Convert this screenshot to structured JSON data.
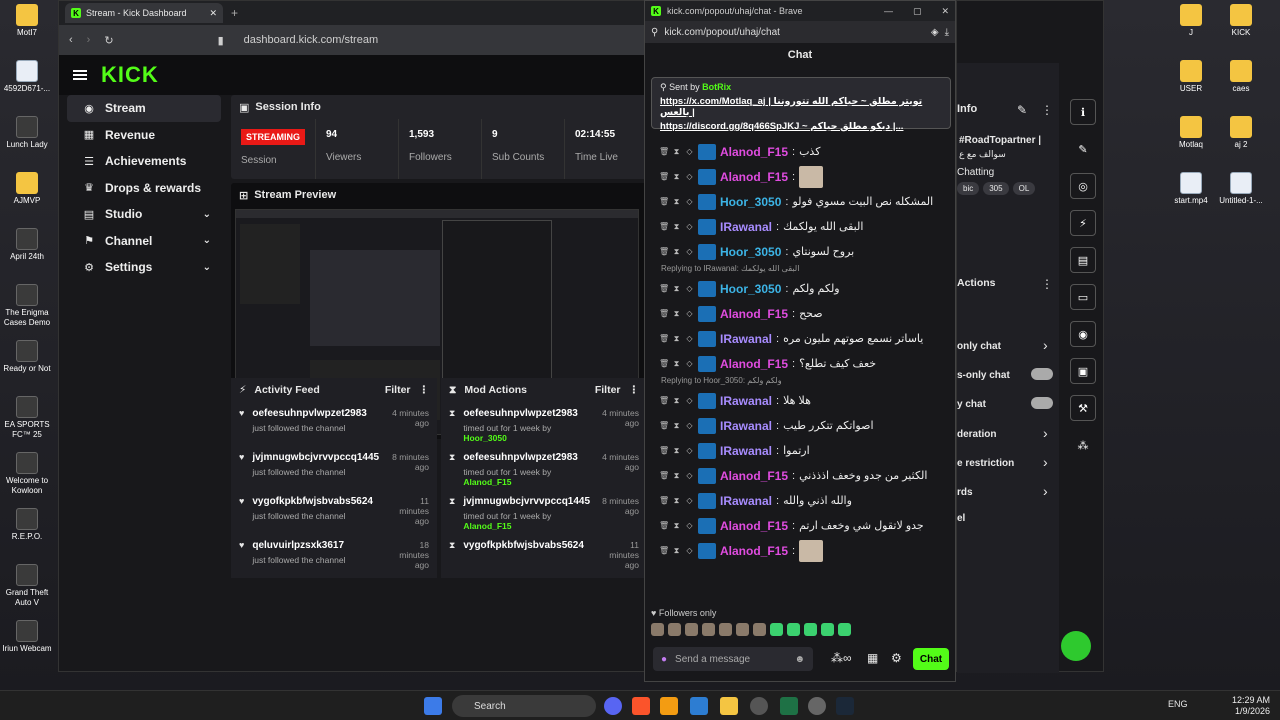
{
  "desktop_left": [
    {
      "label": "MotI7",
      "type": "folder"
    },
    {
      "label": "4592D671-...",
      "type": "file"
    },
    {
      "label": "Lunch Lady",
      "type": "app"
    },
    {
      "label": "AJMVP",
      "type": "folder"
    },
    {
      "label": "April 24th",
      "type": "app"
    },
    {
      "label": "The Enigma Cases Demo",
      "type": "app"
    },
    {
      "label": "Ready or Not",
      "type": "app"
    },
    {
      "label": "EA SPORTS FC™ 25",
      "type": "app"
    },
    {
      "label": "Welcome to Kowloon",
      "type": "app"
    },
    {
      "label": "R.E.P.O.",
      "type": "app"
    },
    {
      "label": "Grand Theft Auto V",
      "type": "app"
    },
    {
      "label": "Iriun Webcam",
      "type": "app"
    }
  ],
  "desktop_right": [
    {
      "label": "J",
      "type": "folder"
    },
    {
      "label": "KICK",
      "type": "folder"
    },
    {
      "label": "USER",
      "type": "folder"
    },
    {
      "label": "caes",
      "type": "folder"
    },
    {
      "label": "Motlaq",
      "type": "folder"
    },
    {
      "label": "aj 2",
      "type": "folder"
    },
    {
      "label": "start.mp4",
      "type": "file"
    },
    {
      "label": "Untitled-1-...",
      "type": "file"
    }
  ],
  "browser": {
    "tab_title": "Stream - Kick Dashboard",
    "url": "dashboard.kick.com/stream",
    "logo": "KICK"
  },
  "sidebar": [
    {
      "label": "Stream",
      "icon": "stream-icon",
      "glyph": "◉",
      "active": true,
      "chev": ""
    },
    {
      "label": "Revenue",
      "icon": "revenue-icon",
      "glyph": "▦",
      "active": false,
      "chev": ""
    },
    {
      "label": "Achievements",
      "icon": "achievements-icon",
      "glyph": "☰",
      "active": false,
      "chev": ""
    },
    {
      "label": "Drops & rewards",
      "icon": "drops-icon",
      "glyph": "♛",
      "active": false,
      "chev": ""
    },
    {
      "label": "Studio",
      "icon": "studio-icon",
      "glyph": "▤",
      "active": false,
      "chev": "⌄"
    },
    {
      "label": "Channel",
      "icon": "channel-icon",
      "glyph": "⚑",
      "active": false,
      "chev": "⌄"
    },
    {
      "label": "Settings",
      "icon": "settings-icon",
      "glyph": "⚙",
      "active": false,
      "chev": "⌄"
    }
  ],
  "session": {
    "title": "Session Info",
    "status": "STREAMING",
    "status_label": "Session",
    "stats": [
      {
        "value": "94",
        "label": "Viewers"
      },
      {
        "value": "1,593",
        "label": "Followers"
      },
      {
        "value": "9",
        "label": "Sub Counts"
      },
      {
        "value": "02:14:55",
        "label": "Time Live"
      }
    ]
  },
  "preview": {
    "title": "Stream Preview"
  },
  "activity": {
    "title": "Activity Feed",
    "filter": "Filter",
    "items": [
      {
        "name": "oefeesuhnpvlwpzet2983",
        "sub": "just followed the channel",
        "time": "4 minutes ago"
      },
      {
        "name": "jvjmnugwbcjvrvvpccq1445",
        "sub": "just followed the channel",
        "time": "8 minutes ago"
      },
      {
        "name": "vygofkpkbfwjsbvabs5624",
        "sub": "just followed the channel",
        "time": "11 minutes ago"
      },
      {
        "name": "qeluvuirlpzsxk3617",
        "sub": "just followed the channel",
        "time": "18 minutes ago"
      }
    ]
  },
  "modactions": {
    "title": "Mod Actions",
    "filter": "Filter",
    "items": [
      {
        "name": "oefeesuhnpvlwpzet2983",
        "sub": "timed out for 1 week by",
        "by": "Hoor_3050",
        "time": "4 minutes ago"
      },
      {
        "name": "oefeesuhnpvlwpzet2983",
        "sub": "timed out for 1 week by",
        "by": "Alanod_F15",
        "time": "4 minutes ago"
      },
      {
        "name": "jvjmnugwbcjvrvvpccq1445",
        "sub": "timed out for 1 week by",
        "by": "Alanod_F15",
        "time": "8 minutes ago"
      },
      {
        "name": "vygofkpkbfwjsbvabs5624",
        "sub": "",
        "by": "",
        "time": "11 minutes ago"
      }
    ]
  },
  "chat": {
    "window_title": "kick.com/popout/uhaj/chat - Brave",
    "url": "kick.com/popout/uhaj/chat",
    "header": "Chat",
    "pinned": {
      "sent_by": "Sent by",
      "bot": "BotRix",
      "line1": "https://x.com/Motlaq_aj | تويتر مطلق ~ حياكم الله تتوروننا بالعس |",
      "line2": "https://discord.gg/8q466SpJKJ ~ ديكو مطلق حياكم |..."
    },
    "messages": [
      {
        "user": "Alanod_F15",
        "color": "#e04ce0",
        "text": "كذب",
        "reply": ""
      },
      {
        "user": "Alanod_F15",
        "color": "#e04ce0",
        "text": "",
        "reply": ""
      },
      {
        "user": "Hoor_3050",
        "color": "#3cb4e6",
        "text": "المشكله نص البيت مسوي فولو",
        "reply": ""
      },
      {
        "user": "IRawanal",
        "color": "#a88cff",
        "text": "البقى الله يولكمك",
        "reply": ""
      },
      {
        "user": "Hoor_3050",
        "color": "#3cb4e6",
        "text": "بروح لسونتاي",
        "reply": ""
      },
      {
        "user": "Hoor_3050",
        "color": "#3cb4e6",
        "text": "ولكم ولكم",
        "reply": "Replying to IRawanal: البقى الله يولكمك"
      },
      {
        "user": "Alanod_F15",
        "color": "#e04ce0",
        "text": "صحح",
        "reply": ""
      },
      {
        "user": "IRawanal",
        "color": "#a88cff",
        "text": "ياساتر نسمع صوتهم مليون مره",
        "reply": ""
      },
      {
        "user": "Alanod_F15",
        "color": "#e04ce0",
        "text": "خعف كيف تطلع؟",
        "reply": ""
      },
      {
        "user": "IRawanal",
        "color": "#a88cff",
        "text": "هلا هلا",
        "reply": "Replying to Hoor_3050: ولكم ولكم"
      },
      {
        "user": "IRawanal",
        "color": "#a88cff",
        "text": "اصواتكم تتكرر طيب",
        "reply": ""
      },
      {
        "user": "IRawanal",
        "color": "#a88cff",
        "text": "ارتموا",
        "reply": ""
      },
      {
        "user": "Alanod_F15",
        "color": "#e04ce0",
        "text": "الكثير من جدو وخعف اذذذني",
        "reply": ""
      },
      {
        "user": "IRawanal",
        "color": "#a88cff",
        "text": "والله اذني والله",
        "reply": ""
      },
      {
        "user": "Alanod_F15",
        "color": "#e04ce0",
        "text": "جدو لاتقول شي وخعف ارتم",
        "reply": ""
      },
      {
        "user": "Alanod_F15",
        "color": "#e04ce0",
        "text": "",
        "reply": ""
      }
    ],
    "followers_only": "Followers only",
    "input_placeholder": "Send a message",
    "send": "Chat"
  },
  "right_panel": {
    "info": "Info",
    "tags": [
      "#RoadTopartner |",
      "سوالف مع ع"
    ],
    "category": "Chatting",
    "chips": [
      "bic",
      "305",
      "OL"
    ],
    "actions": "Actions",
    "rows": [
      "only chat",
      "s-only chat",
      "y chat",
      "deration",
      "e restriction",
      "rds",
      "el"
    ]
  },
  "taskbar": {
    "search": "Search",
    "lang": "ENG",
    "time": "12:29 AM",
    "date": "1/9/2026"
  }
}
